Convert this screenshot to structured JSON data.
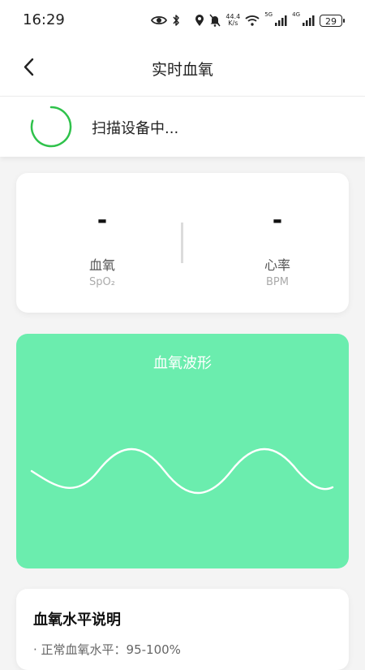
{
  "status_bar": {
    "time": "16:29",
    "net_speed_value": "44.4",
    "net_speed_unit": "K/s",
    "signal1_label": "5G",
    "signal2_label": "4G",
    "battery": "29"
  },
  "header": {
    "title": "实时血氧",
    "back_icon": "chevron-left-icon"
  },
  "scan": {
    "text": "扫描设备中...",
    "spinner_color": "#2fc24b"
  },
  "metrics": {
    "spo2": {
      "value": "-",
      "label": "血氧",
      "unit": "SpO₂"
    },
    "heart_rate": {
      "value": "-",
      "label": "心率",
      "unit": "BPM"
    }
  },
  "waveform": {
    "title": "血氧波形",
    "background_color": "#6bedae",
    "line_color": "#ffffff"
  },
  "info": {
    "title": "血氧水平说明",
    "items": [
      "· 正常血氧水平：95-100%"
    ]
  }
}
